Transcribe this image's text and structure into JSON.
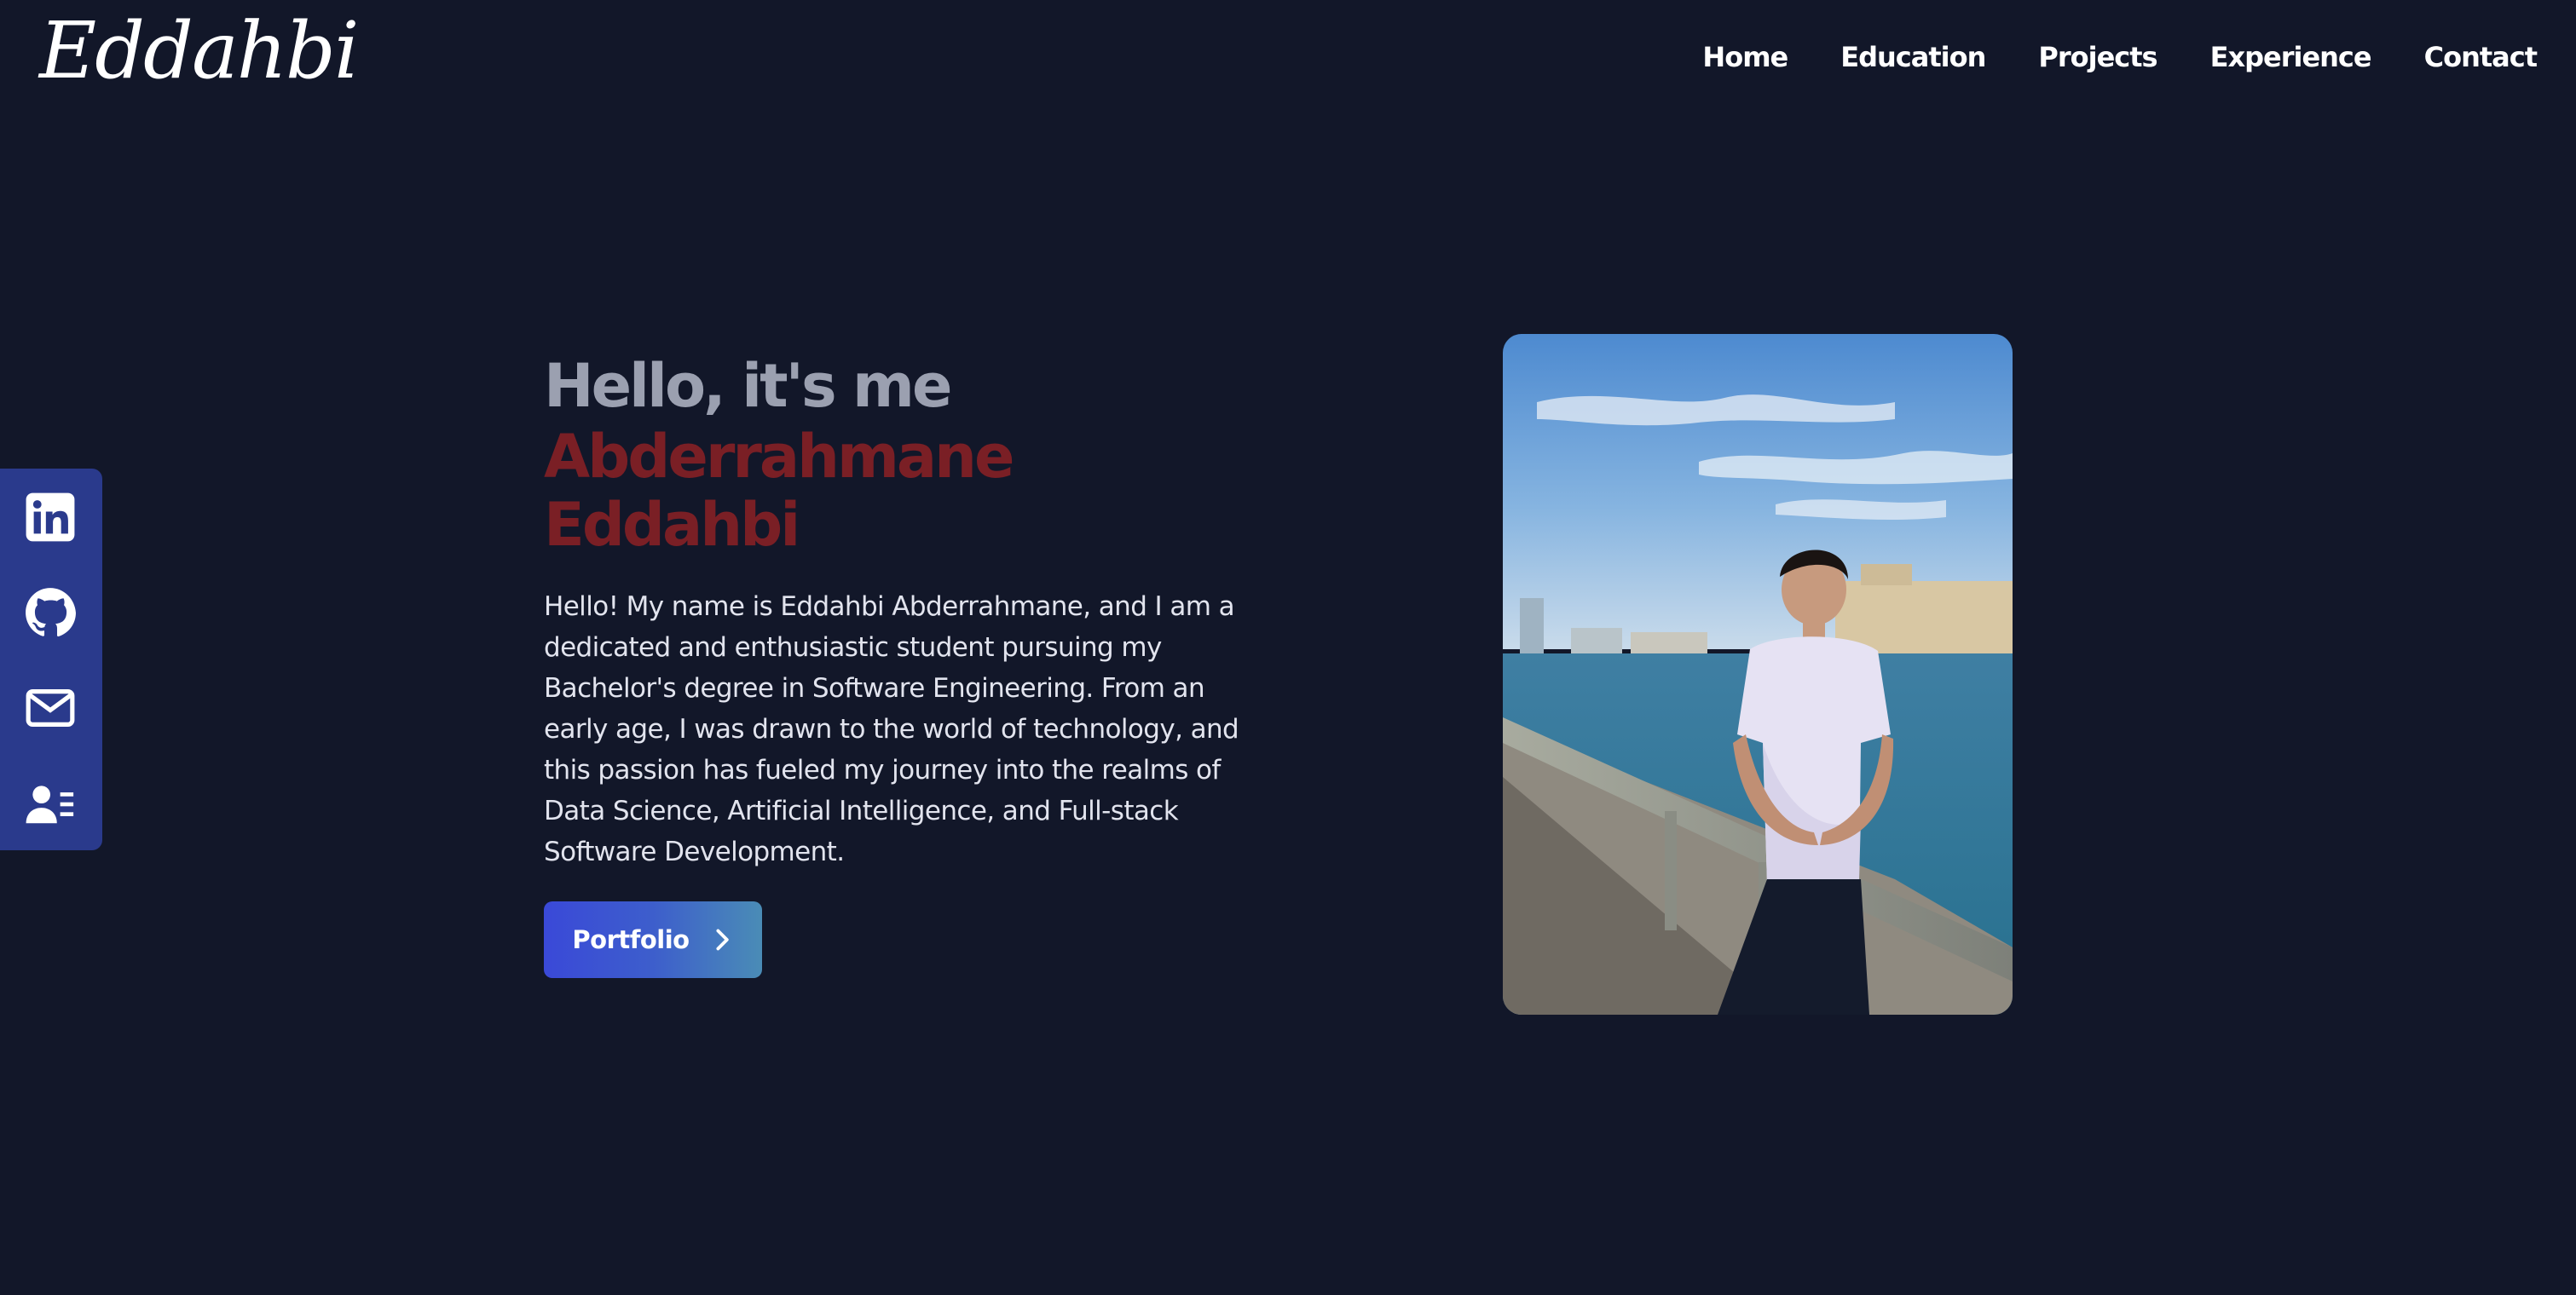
{
  "header": {
    "logo_text": "Eddahbi",
    "nav": [
      {
        "label": "Home"
      },
      {
        "label": "Education"
      },
      {
        "label": "Projects"
      },
      {
        "label": "Experience"
      },
      {
        "label": "Contact"
      }
    ]
  },
  "social": [
    {
      "icon": "linkedin-icon"
    },
    {
      "icon": "github-icon"
    },
    {
      "icon": "mail-icon"
    },
    {
      "icon": "resume-icon"
    }
  ],
  "hero": {
    "greeting": "Hello, it's me",
    "name": "Abderrahmane Eddahbi",
    "bio": "Hello! My name is Eddahbi Abderrahmane, and I am a dedicated and enthusiastic student pursuing my Bachelor's degree in Software Engineering. From an early age, I was drawn to the world of technology, and this passion has fueled my journey into the realms of Data Science, Artificial Intelligence, and Full-stack Software Development.",
    "button_label": "Portfolio",
    "button_icon": "chevron-right-icon"
  },
  "colors": {
    "background": "#121729",
    "accent_name": "#7a1f25",
    "greeting": "#9ba0b0",
    "sidebar": "#2a3a8c",
    "button_gradient_start": "#3a49d8",
    "button_gradient_end": "#4a8cb6"
  }
}
